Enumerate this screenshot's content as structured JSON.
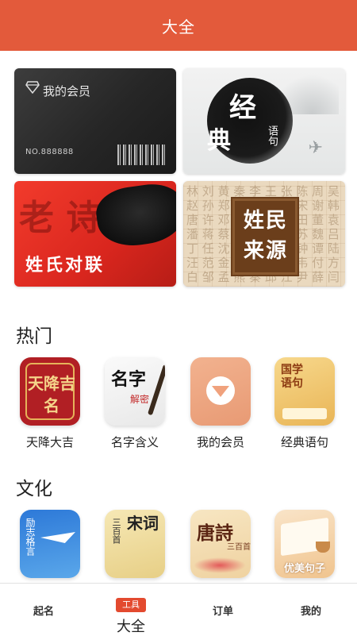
{
  "header": {
    "title": "大全"
  },
  "banners": {
    "member_card": {
      "title": "我的会员",
      "number": "NO.888888"
    },
    "classic": {
      "line1": "经",
      "line2": "典",
      "side": "语句"
    },
    "couplet": {
      "bg_text": "老 诗",
      "title": "姓氏对联"
    },
    "surname": {
      "text": "姓民来源",
      "pattern": "林 刘 黄 秦 李 王 张 陈 周 吴 赵 孙 郑 冯 何 高 罗 宋 谢 韩 唐 许 邓 萧 曹 彭 曾 田 董 袁 潘 蒋 蔡 余 杜 叶 程 苏 魏 吕 丁 任 沈 姚 卢 姜 崔 钟 谭 陆 汪 范 金 石 廖 贾 夏 韦 付 方 白 邹 孟 熊 秦 邱 江 尹 薛 闫 段 雷 侯 龙 史 陶 黎 贺 顾 毛 郝 龚 邵 万 钱 严 覃 武 戴 莫 孔 向 汤"
    }
  },
  "sections": {
    "hot": {
      "title": "热门",
      "items": [
        {
          "label": "天降大吉",
          "tile_text": "天降吉名"
        },
        {
          "label": "名字含义",
          "tile_text": "名字",
          "tile_sub": "解密"
        },
        {
          "label": "我的会员"
        },
        {
          "label": "经典语句",
          "tile_text": "国学语句"
        }
      ]
    },
    "culture": {
      "title": "文化",
      "items": [
        {
          "tile_text": "励志格言"
        },
        {
          "tile_text": "宋词",
          "tile_small": "三百首"
        },
        {
          "tile_text": "唐詩",
          "tile_sub": "三百首"
        },
        {
          "tile_text": "优美句子"
        }
      ]
    }
  },
  "tabbar": {
    "items": [
      {
        "label": "起名"
      },
      {
        "badge": "工具",
        "label": "大全"
      },
      {
        "label": "订单"
      },
      {
        "label": "我的"
      }
    ]
  },
  "colors": {
    "header_bg": "#e35a3b",
    "tab_badge": "#e34a2f"
  }
}
